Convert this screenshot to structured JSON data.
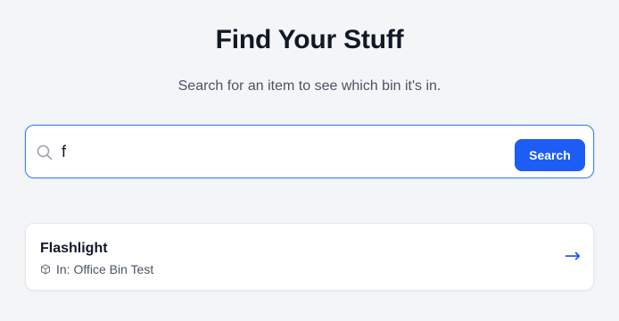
{
  "header": {
    "title": "Find Your Stuff",
    "subtitle": "Search for an item to see which bin it's in."
  },
  "search": {
    "value": "f",
    "button_label": "Search",
    "icon": "search-icon"
  },
  "results": [
    {
      "name": "Flashlight",
      "location": "In: Office Bin Test",
      "location_icon": "box-icon",
      "action_icon": "arrow-right-icon",
      "action_glyph": "→"
    }
  ],
  "colors": {
    "accent": "#1d5cf5",
    "background": "#f4f5f7",
    "focus_border": "#3b82f6"
  }
}
